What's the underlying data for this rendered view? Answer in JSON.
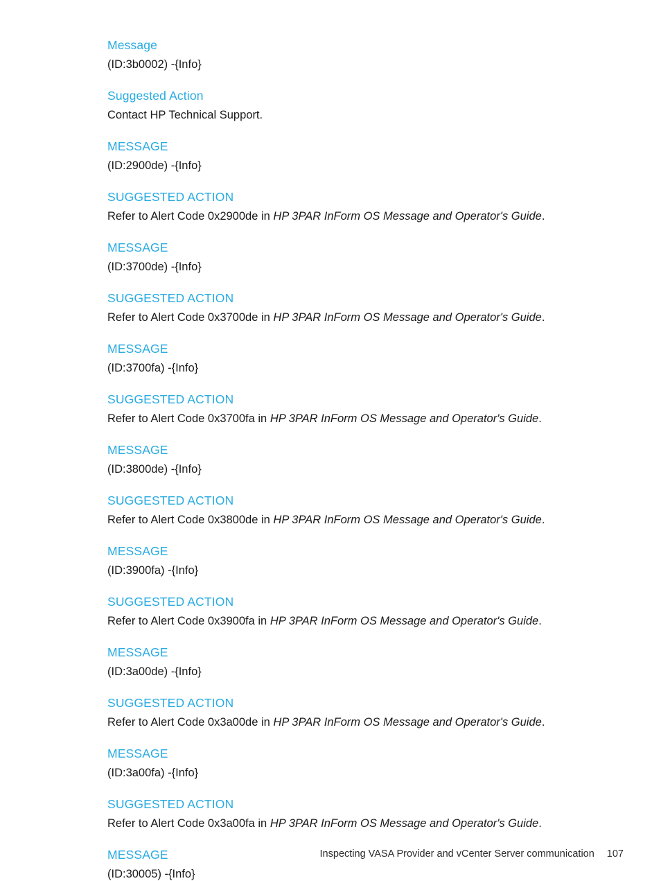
{
  "document": {
    "page_number": "107",
    "footer_title": "Inspecting VASA Provider and vCenter Server communication",
    "heading_color": "#28ABE2",
    "body_color": "#1a1a1a"
  },
  "sections": [
    {
      "heading": "Message",
      "body_prefix": "(ID:3b0002) -{Info}",
      "body_italic": "",
      "body_suffix": ""
    },
    {
      "heading": "Suggested Action",
      "body_prefix": "Contact HP Technical Support.",
      "body_italic": "",
      "body_suffix": ""
    },
    {
      "heading": "MESSAGE",
      "body_prefix": "(ID:2900de) -{Info}",
      "body_italic": "",
      "body_suffix": ""
    },
    {
      "heading": "SUGGESTED ACTION",
      "body_prefix": "Refer to Alert Code 0x2900de in ",
      "body_italic": "HP 3PAR InForm OS Message and Operator's Guide",
      "body_suffix": "."
    },
    {
      "heading": "MESSAGE",
      "body_prefix": "(ID:3700de) -{Info}",
      "body_italic": "",
      "body_suffix": ""
    },
    {
      "heading": "SUGGESTED ACTION",
      "body_prefix": "Refer to Alert Code 0x3700de in ",
      "body_italic": "HP 3PAR InForm OS Message and Operator's Guide",
      "body_suffix": "."
    },
    {
      "heading": "MESSAGE",
      "body_prefix": "(ID:3700fa) -{Info}",
      "body_italic": "",
      "body_suffix": ""
    },
    {
      "heading": "SUGGESTED ACTION",
      "body_prefix": "Refer to Alert Code 0x3700fa in ",
      "body_italic": "HP 3PAR InForm OS Message and Operator's Guide",
      "body_suffix": "."
    },
    {
      "heading": "MESSAGE",
      "body_prefix": "(ID:3800de) -{Info}",
      "body_italic": "",
      "body_suffix": ""
    },
    {
      "heading": "SUGGESTED ACTION",
      "body_prefix": "Refer to Alert Code 0x3800de in ",
      "body_italic": "HP 3PAR InForm OS Message and Operator's Guide",
      "body_suffix": "."
    },
    {
      "heading": "MESSAGE",
      "body_prefix": "(ID:3900fa) -{Info}",
      "body_italic": "",
      "body_suffix": ""
    },
    {
      "heading": "SUGGESTED ACTION",
      "body_prefix": "Refer to Alert Code 0x3900fa in ",
      "body_italic": "HP 3PAR InForm OS Message and Operator's Guide",
      "body_suffix": "."
    },
    {
      "heading": "MESSAGE",
      "body_prefix": "(ID:3a00de) -{Info}",
      "body_italic": "",
      "body_suffix": ""
    },
    {
      "heading": "SUGGESTED ACTION",
      "body_prefix": "Refer to Alert Code 0x3a00de in ",
      "body_italic": "HP 3PAR InForm OS Message and Operator's Guide",
      "body_suffix": "."
    },
    {
      "heading": "MESSAGE",
      "body_prefix": "(ID:3a00fa) -{Info}",
      "body_italic": "",
      "body_suffix": ""
    },
    {
      "heading": "SUGGESTED ACTION",
      "body_prefix": "Refer to Alert Code 0x3a00fa in ",
      "body_italic": "HP 3PAR InForm OS Message and Operator's Guide",
      "body_suffix": "."
    },
    {
      "heading": "MESSAGE",
      "body_prefix": "(ID:30005) -{Info}",
      "body_italic": "",
      "body_suffix": ""
    }
  ]
}
